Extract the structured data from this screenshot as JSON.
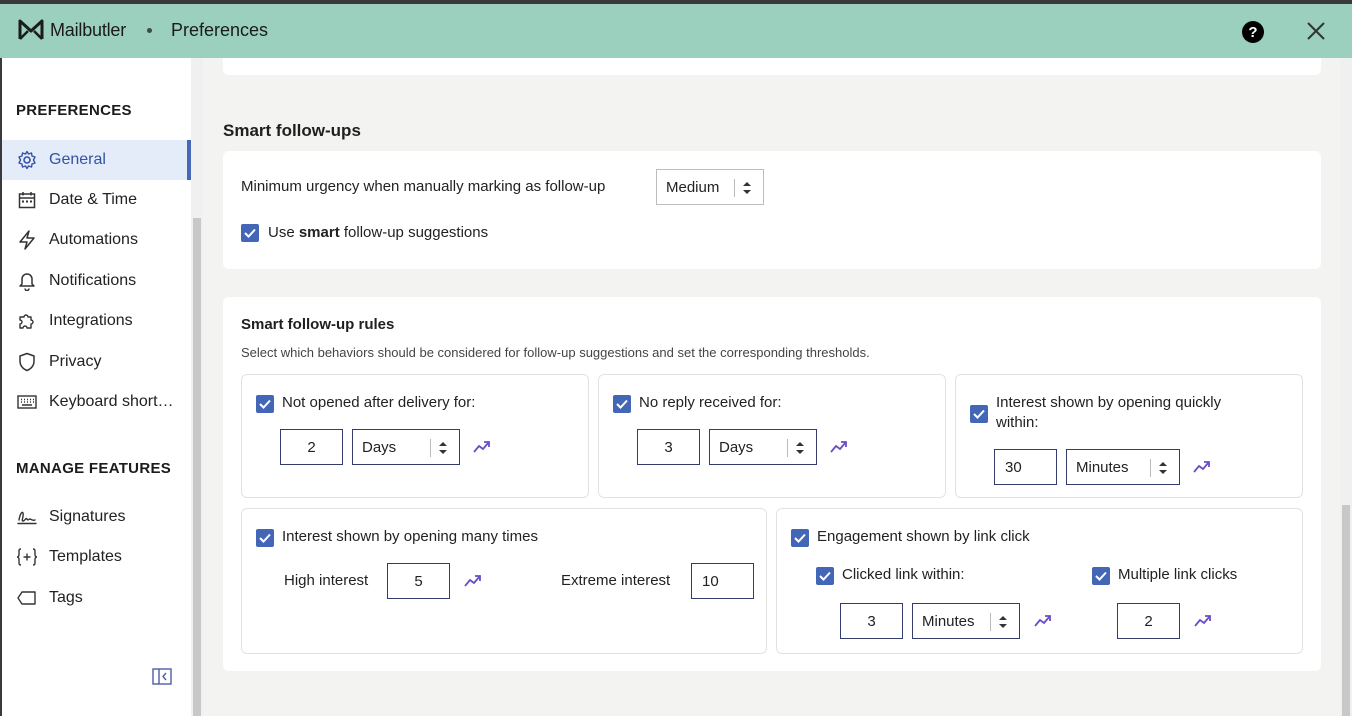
{
  "app": {
    "name": "Mailbutler",
    "page": "Preferences"
  },
  "sidebar": {
    "section1": "PREFERENCES",
    "items": [
      {
        "label": "General",
        "icon": "gear-icon"
      },
      {
        "label": "Date & Time",
        "icon": "calendar-icon"
      },
      {
        "label": "Automations",
        "icon": "lightning-icon"
      },
      {
        "label": "Notifications",
        "icon": "bell-icon"
      },
      {
        "label": "Integrations",
        "icon": "puzzle-icon"
      },
      {
        "label": "Privacy",
        "icon": "shield-icon"
      },
      {
        "label": "Keyboard short…",
        "icon": "keyboard-icon"
      }
    ],
    "section2": "MANAGE FEATURES",
    "features": [
      {
        "label": "Signatures",
        "icon": "signature-icon"
      },
      {
        "label": "Templates",
        "icon": "braces-icon"
      },
      {
        "label": "Tags",
        "icon": "tag-icon"
      }
    ]
  },
  "followups": {
    "title": "Smart follow-ups",
    "urgency_label": "Minimum urgency when manually marking as follow-up",
    "urgency_value": "Medium",
    "suggest_prefix": "Use ",
    "suggest_bold": "smart",
    "suggest_suffix": " follow-up suggestions"
  },
  "rules": {
    "title": "Smart follow-up rules",
    "description": "Select which behaviors should be considered for follow-up suggestions and set the corresponding thresholds.",
    "not_opened": {
      "label": "Not opened after delivery for:",
      "value": "2",
      "unit": "Days"
    },
    "no_reply": {
      "label": "No reply received for:",
      "value": "3",
      "unit": "Days"
    },
    "quick_open": {
      "label_line1": "Interest shown by opening quickly",
      "label_line2": "within:",
      "value": "30",
      "unit": "Minutes"
    },
    "many_times": {
      "label": "Interest shown by opening many times",
      "high_label": "High interest",
      "high_value": "5",
      "extreme_label": "Extreme interest",
      "extreme_value": "10"
    },
    "link_click": {
      "label": "Engagement shown by link click",
      "within_label": "Clicked link within:",
      "within_value": "3",
      "within_unit": "Minutes",
      "multiple_label": "Multiple link clicks",
      "multiple_value": "2"
    }
  },
  "colors": {
    "header": "#9ad0bd",
    "accent": "#4466b6",
    "trend": "#6a4fc4"
  }
}
